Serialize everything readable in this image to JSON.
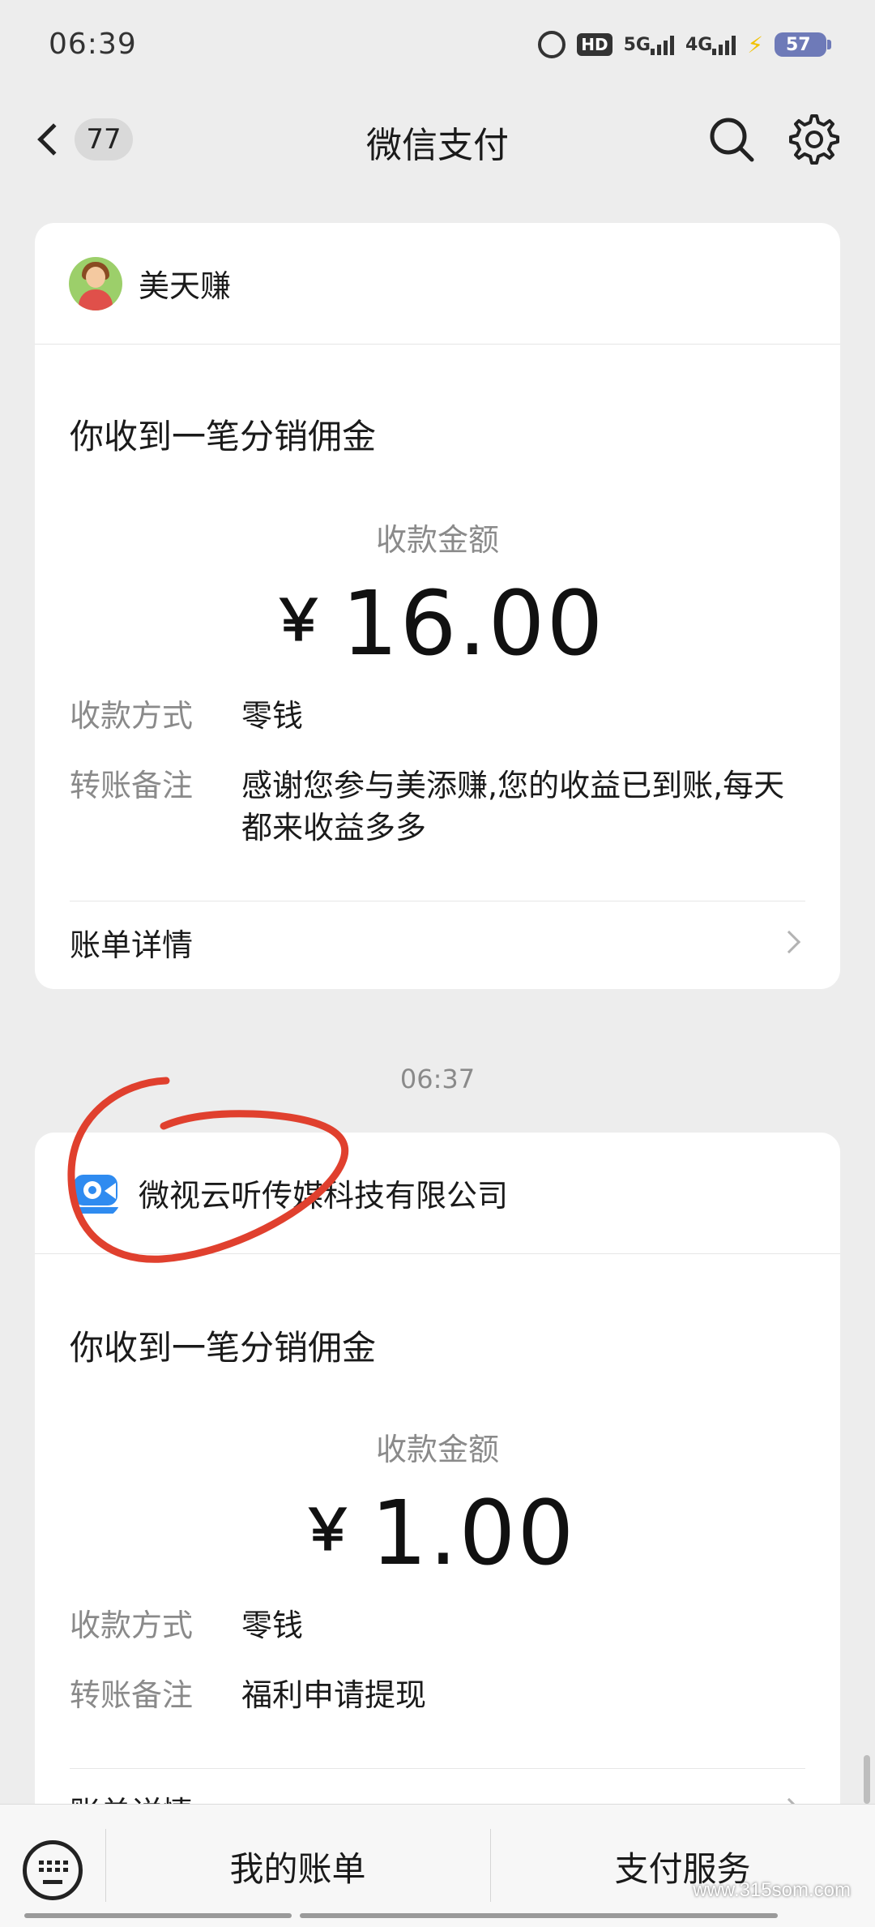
{
  "status_bar": {
    "time": "06:39",
    "hd": "HD",
    "net_5g": "5G",
    "net_4g": "4G",
    "battery": "57"
  },
  "nav": {
    "back_count": "77",
    "title": "微信支付",
    "icons": [
      "chevron-left-icon",
      "search-icon",
      "gear-icon"
    ]
  },
  "cards": [
    {
      "merchant": "美天赚",
      "title": "你收到一笔分销佣金",
      "amount_label": "收款金额",
      "currency": "￥",
      "amount": "16.00",
      "rows": [
        {
          "label": "收款方式",
          "value": "零钱"
        },
        {
          "label": "转账备注",
          "value": "感谢您参与美添赚,您的收益已到账,每天都来收益多多"
        }
      ],
      "detail_label": "账单详情"
    },
    {
      "merchant": "微视云听传媒科技有限公司",
      "title": "你收到一笔分销佣金",
      "amount_label": "收款金额",
      "currency": "￥",
      "amount": "1.00",
      "rows": [
        {
          "label": "收款方式",
          "value": "零钱"
        },
        {
          "label": "转账备注",
          "value": "福利申请提现"
        }
      ],
      "detail_label": "账单详情"
    }
  ],
  "timestamp": "06:37",
  "bottom_bar": {
    "tabs": [
      "我的账单",
      "支付服务"
    ]
  },
  "watermark": "www.315som.com",
  "colors": {
    "background": "#ededed",
    "card": "#ffffff",
    "annotation": "#e0402e",
    "muted_text": "#8a8a8a"
  }
}
